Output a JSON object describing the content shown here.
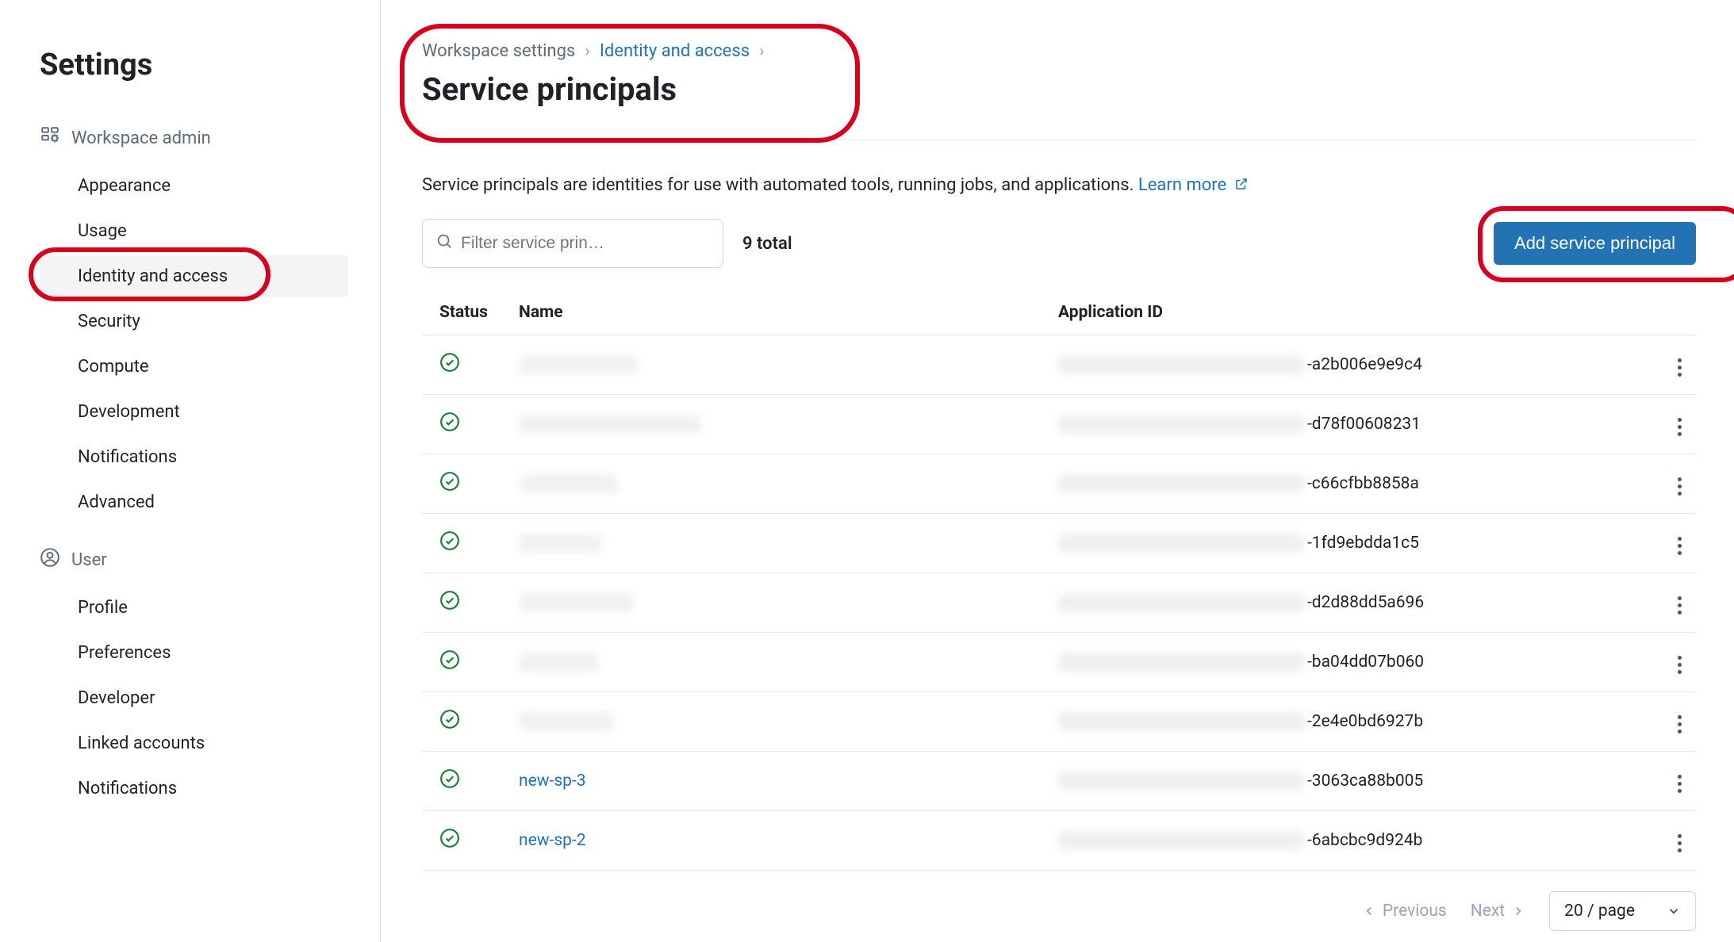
{
  "sidebar": {
    "title": "Settings",
    "groups": [
      {
        "label": "Workspace admin",
        "icon": "workspace-admin-icon",
        "items": [
          {
            "label": "Appearance",
            "active": false
          },
          {
            "label": "Usage",
            "active": false
          },
          {
            "label": "Identity and access",
            "active": true,
            "highlighted": true
          },
          {
            "label": "Security",
            "active": false
          },
          {
            "label": "Compute",
            "active": false
          },
          {
            "label": "Development",
            "active": false
          },
          {
            "label": "Notifications",
            "active": false
          },
          {
            "label": "Advanced",
            "active": false
          }
        ]
      },
      {
        "label": "User",
        "icon": "user-icon",
        "items": [
          {
            "label": "Profile",
            "active": false
          },
          {
            "label": "Preferences",
            "active": false
          },
          {
            "label": "Developer",
            "active": false
          },
          {
            "label": "Linked accounts",
            "active": false
          },
          {
            "label": "Notifications",
            "active": false
          }
        ]
      }
    ]
  },
  "breadcrumb": {
    "parent": "Workspace settings",
    "section": "Identity and access"
  },
  "page_title": "Service principals",
  "intro": {
    "text": "Service principals are identities for use with automated tools, running jobs, and applications. ",
    "link_text": "Learn more"
  },
  "filter": {
    "placeholder": "Filter service prin…"
  },
  "total_label": "9 total",
  "add_button": "Add service principal",
  "table": {
    "headers": {
      "status": "Status",
      "name": "Name",
      "app_id": "Application ID"
    },
    "rows": [
      {
        "status": "ok",
        "name": "",
        "name_redacted": true,
        "app_suffix": "-a2b006e9e9c4"
      },
      {
        "status": "ok",
        "name": "",
        "name_redacted": true,
        "app_suffix": "-d78f00608231"
      },
      {
        "status": "ok",
        "name": "",
        "name_redacted": true,
        "app_suffix": "-c66cfbb8858a"
      },
      {
        "status": "ok",
        "name": "",
        "name_redacted": true,
        "app_suffix": "-1fd9ebdda1c5"
      },
      {
        "status": "ok",
        "name": "",
        "name_redacted": true,
        "app_suffix": "-d2d88dd5a696"
      },
      {
        "status": "ok",
        "name": "",
        "name_redacted": true,
        "app_suffix": "-ba04dd07b060"
      },
      {
        "status": "ok",
        "name": "",
        "name_redacted": true,
        "app_suffix": "-2e4e0bd6927b"
      },
      {
        "status": "ok",
        "name": "new-sp-3",
        "name_redacted": false,
        "app_suffix": "-3063ca88b005"
      },
      {
        "status": "ok",
        "name": "new-sp-2",
        "name_redacted": false,
        "app_suffix": "-6abcbc9d924b"
      }
    ]
  },
  "pagination": {
    "previous": "Previous",
    "next": "Next",
    "page_size": "20 / page"
  },
  "highlights": {
    "header_box": true,
    "sidebar_item": true,
    "add_button_box": true
  }
}
